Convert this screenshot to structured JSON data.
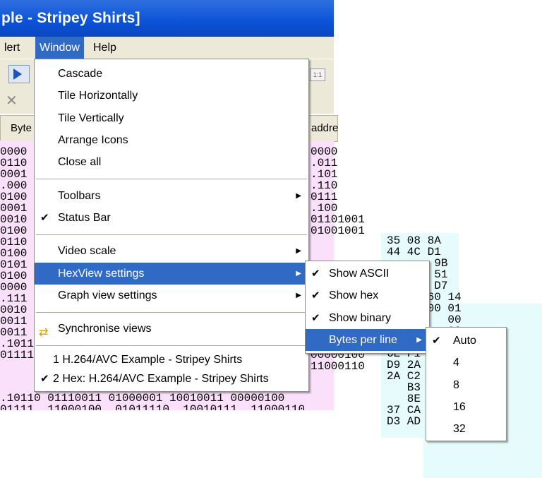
{
  "window": {
    "title": "ple - Stripey Shirts]",
    "menubar": [
      "lert",
      "Window",
      "Help"
    ],
    "column_headers": [
      "Byte",
      "addre"
    ]
  },
  "hex_view": {
    "binary_left": "0000\n0110\n0001\n.000\n0100\n0001\n0010\n0100\n0110\n0100\n0101\n0100\n0000\n.111\n0010\n0011\n0011\n.10110\n01111",
    "binary_mid": "0000\n.011\n.101\n.110\n0111\n.100\n01101001\n01001001\n\n\n\n\n\n\n\n\n01101001\n11101010\n00000100\n11000110",
    "bottom_row": ".10110 01110011 01000001 10010011 00000100",
    "bottom_row2": "01111  11000100  01011110  10010111  11000110",
    "hex_rows_a": "35 08 8A\n44 4C D1\n       9B\n       51\n       D7\n91 CA 60 14\n00 00 00 01\n         00\n         08\nFA 69    5D\n6E F1    D8\nD9 2A    93\n2A C2    97\n   B3    88\n   8E    D2\n37 CA DF 42 E4\nD3 AD 0C 2A DE"
  },
  "menus": {
    "window_menu": {
      "items": [
        {
          "label": "Cascade"
        },
        {
          "label": "Tile Horizontally"
        },
        {
          "label": "Tile Vertically"
        },
        {
          "label": "Arrange Icons"
        },
        {
          "label": "Close all"
        },
        {
          "label": "Toolbars"
        },
        {
          "label": "Status Bar",
          "checked": true
        },
        {
          "label": "Video scale"
        },
        {
          "label": "HexView settings",
          "highlighted": true
        },
        {
          "label": "Graph view settings"
        },
        {
          "label": "Synchronise views"
        },
        {
          "label": "1 H.264/AVC Example - Stripey Shirts"
        },
        {
          "label": "2 Hex: H.264/AVC Example - Stripey Shirts",
          "checked": true
        }
      ]
    },
    "hexview_submenu": {
      "items": [
        {
          "label": "Show ASCII",
          "checked": true
        },
        {
          "label": "Show hex",
          "checked": true
        },
        {
          "label": "Show binary",
          "checked": true
        },
        {
          "label": "Bytes per line",
          "highlighted": true
        }
      ]
    },
    "bytes_submenu": {
      "items": [
        {
          "label": "Auto",
          "checked": true
        },
        {
          "label": "4"
        },
        {
          "label": "8"
        },
        {
          "label": "16"
        },
        {
          "label": "32"
        }
      ]
    }
  },
  "icons": {
    "play": "play-icon",
    "mute": "mute-icon",
    "sync": "sync-views-icon",
    "submenu": "submenu-arrow-icon",
    "check": "check-icon"
  },
  "colors": {
    "highlight": "#316ac5",
    "title_blue": "#0a52d6",
    "binary_bg": "#fbe0fb",
    "hex_bg": "#e6fbfb",
    "menu_bar": "#ece9d8"
  }
}
